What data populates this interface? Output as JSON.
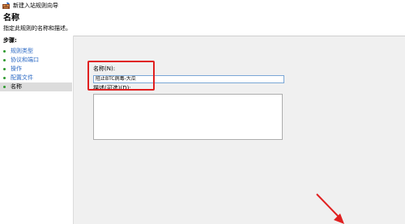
{
  "window": {
    "title": "新建入站规则向导"
  },
  "header": {
    "title": "名称",
    "subtitle": "指定此规则的名称和描述。"
  },
  "sidebar": {
    "steps_label": "步骤:",
    "items": [
      {
        "label": "规则类型"
      },
      {
        "label": "协议和端口"
      },
      {
        "label": "操作"
      },
      {
        "label": "配置文件"
      },
      {
        "label": "名称"
      }
    ]
  },
  "form": {
    "name_label": "名称(N):",
    "name_value": "阻止BTC病毒-大瓜",
    "description_label": "描述(可选)(D):",
    "description_value": ""
  },
  "colors": {
    "highlight": "#e02020",
    "step_bullet": "#2e9a2e",
    "step_link": "#2b69c4"
  }
}
